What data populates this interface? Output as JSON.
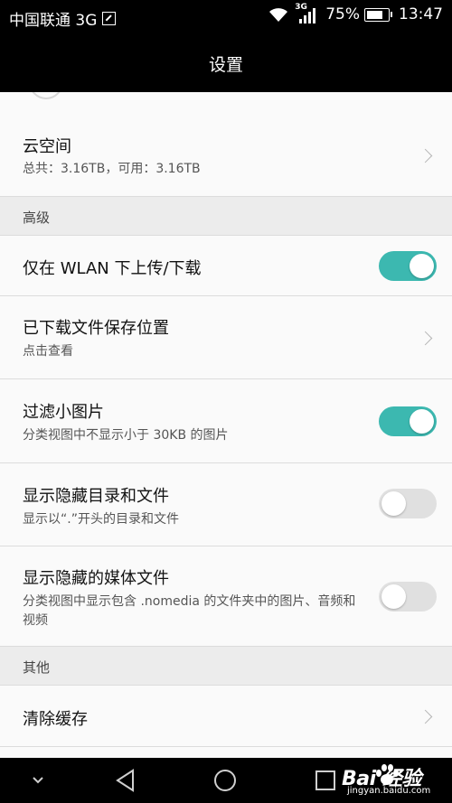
{
  "status_bar": {
    "carrier": "中国联通 3G",
    "network_type": "3G",
    "battery_percent_label": "75%",
    "battery_level": 0.75,
    "time": "13:47"
  },
  "title_bar": {
    "title": "设置"
  },
  "cloud_space": {
    "title": "云空间",
    "subtitle": "总共：3.16TB，可用：3.16TB"
  },
  "section_advanced": {
    "label": "高级"
  },
  "wlan_only": {
    "title": "仅在 WLAN 下上传/下载",
    "enabled": true
  },
  "download_location": {
    "title": "已下载文件保存位置",
    "subtitle": "点击查看"
  },
  "filter_small_images": {
    "title": "过滤小图片",
    "subtitle": "分类视图中不显示小于 30KB 的图片",
    "enabled": true
  },
  "show_hidden": {
    "title": "显示隐藏目录和文件",
    "subtitle": "显示以“.”开头的目录和文件",
    "enabled": false
  },
  "show_hidden_media": {
    "title": "显示隐藏的媒体文件",
    "subtitle": "分类视图中显示包含 .nomedia 的文件夹中的图片、音频和视频",
    "enabled": false
  },
  "section_other": {
    "label": "其他"
  },
  "clear_cache": {
    "title": "清除缓存"
  },
  "watermark": {
    "main": "Bai  经验",
    "sub": "jingyan.baidu.com"
  },
  "colors": {
    "toggle_on": "#3cb8b0",
    "toggle_off": "#e0e0e0",
    "bar_background": "#000000",
    "list_background": "#fafafa",
    "section_background": "#ececec"
  }
}
